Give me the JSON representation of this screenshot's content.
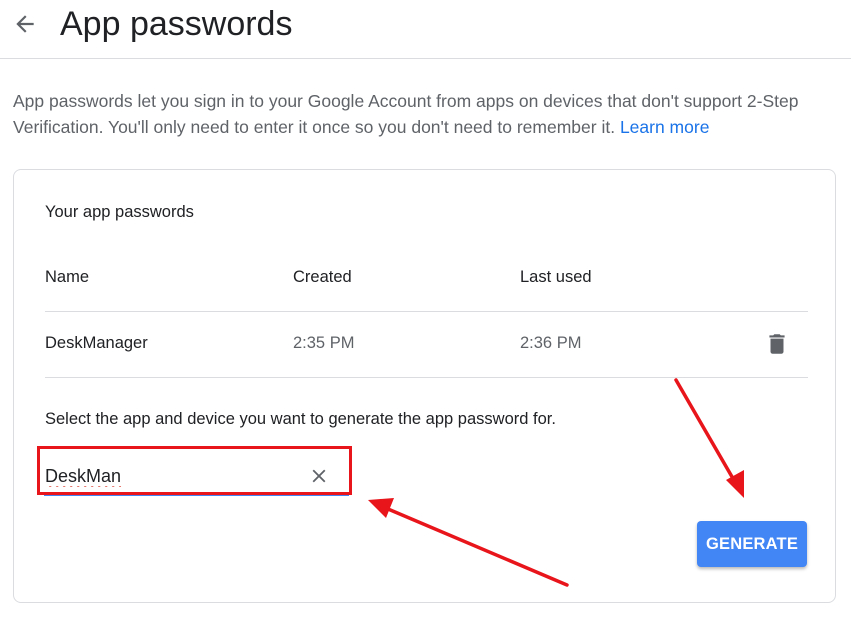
{
  "header": {
    "back_icon": "arrow-back-icon",
    "title": "App passwords"
  },
  "intro": {
    "text": "App passwords let you sign in to your Google Account from apps on devices that don't support 2-Step Verification. You'll only need to enter it once so you don't need to remember it.",
    "link_label": "Learn more"
  },
  "card": {
    "section_title": "Your app passwords",
    "columns": [
      "Name",
      "Created",
      "Last used"
    ],
    "rows": [
      {
        "name": "DeskManager",
        "created": "2:35 PM",
        "last_used": "2:36 PM",
        "action_icon": "trash-icon"
      }
    ],
    "prompt": "Select the app and device you want to generate the app password for.",
    "app_input": {
      "value": "DeskMan",
      "clear_icon": "close-icon"
    },
    "generate_label": "GENERATE"
  },
  "colors": {
    "accent": "#4285f4",
    "link": "#1a73e8",
    "annotation": "#e8151b",
    "divider": "#dadce0"
  }
}
